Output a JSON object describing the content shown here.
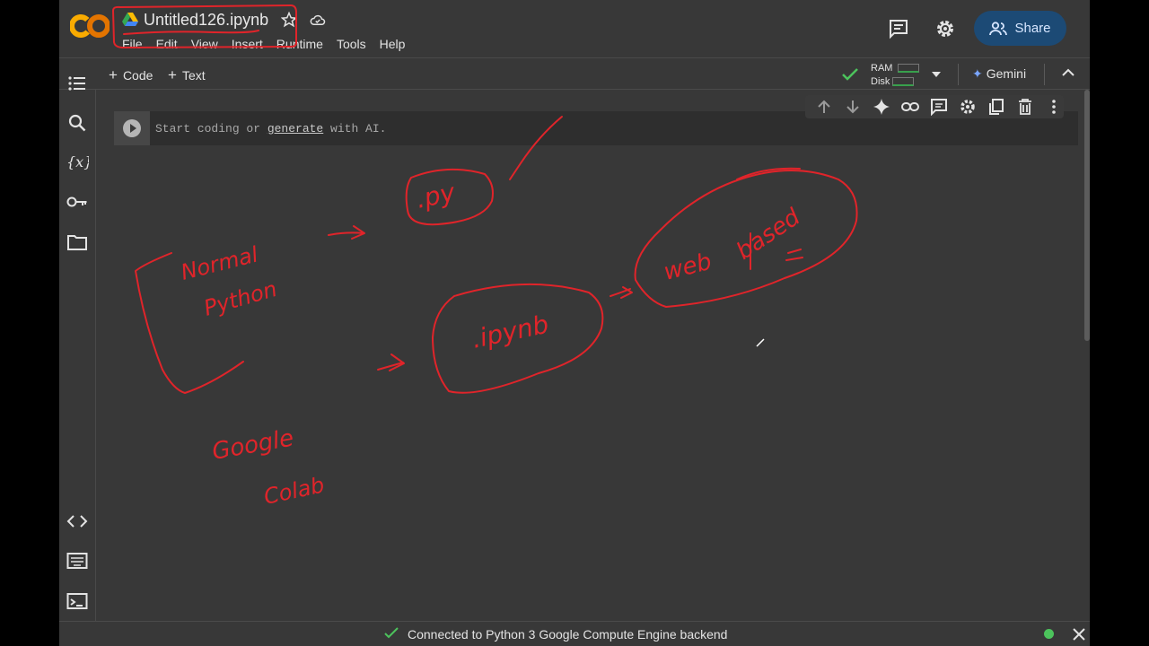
{
  "app": {
    "logo_text": "CO"
  },
  "notebook": {
    "title": "Untitled126.ipynb"
  },
  "menu": [
    "File",
    "Edit",
    "View",
    "Insert",
    "Runtime",
    "Tools",
    "Help"
  ],
  "header": {
    "share_label": "Share"
  },
  "toolbar": {
    "add_code_label": "Code",
    "add_text_label": "Text",
    "ram_label": "RAM",
    "disk_label": "Disk",
    "gemini_label": "Gemini"
  },
  "cell": {
    "placeholder_start": "Start coding or ",
    "placeholder_link": "generate",
    "placeholder_end": " with AI."
  },
  "annotations": {
    "normal_python": "Normal Python",
    "py": ".py",
    "ipynb": ".ipynb",
    "web_based": "web based",
    "google_colab": "Google Colab"
  },
  "status": {
    "text": "Connected to Python 3 Google Compute Engine backend"
  },
  "colors": {
    "ink": "#e0242a",
    "accent": "#f9ab00",
    "share_bg": "#1c4a75",
    "connected": "#4cc35c"
  }
}
